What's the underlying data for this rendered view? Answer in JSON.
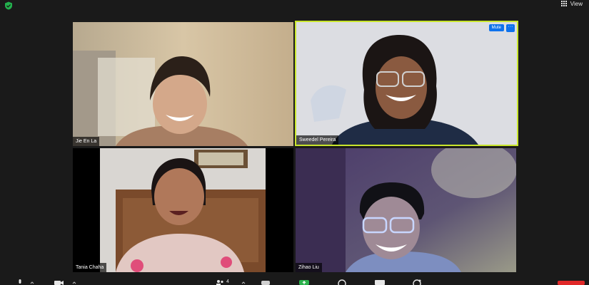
{
  "top_bar": {
    "view_label": "View",
    "security_icon": "shield-check-icon"
  },
  "participants": [
    {
      "name": "Jie En La",
      "active_speaker": false
    },
    {
      "name": "Sweedel Pereira",
      "active_speaker": true,
      "mute_label": "Mute",
      "more_label": "···"
    },
    {
      "name": "Tania Chaha",
      "active_speaker": false
    },
    {
      "name": "Zihao Liu",
      "active_speaker": false
    }
  ],
  "toolbar": {
    "participants_count": "4",
    "icons": [
      "microphone-icon",
      "video-camera-icon",
      "participants-icon",
      "chat-icon",
      "share-screen-icon",
      "record-icon",
      "captions-icon",
      "reactions-icon",
      "end-call-icon"
    ]
  },
  "colors": {
    "active_speaker_border": "#c9e52c",
    "button_blue": "#0e72ed",
    "share_green": "#2bb24c",
    "end_red": "#e02828"
  }
}
